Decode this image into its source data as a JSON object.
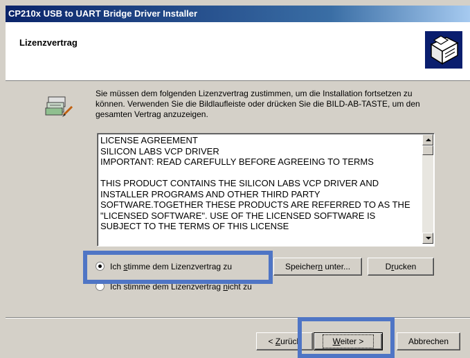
{
  "window": {
    "title": "CP210x USB to UART Bridge Driver Installer"
  },
  "header": {
    "title": "Lizenzvertrag",
    "icon": "installer-box-icon"
  },
  "content": {
    "intro": "Sie müssen dem folgenden Lizenzvertrag zustimmen, um die Installation fortsetzen zu können. Verwenden Sie die Bildlaufleiste oder drücken Sie die BILD-AB-TASTE, um den gesamten Vertrag anzuzeigen.",
    "license_text": "LICENSE AGREEMENT\nSILICON LABS VCP DRIVER\nIMPORTANT:  READ CAREFULLY BEFORE AGREEING TO TERMS\n\nTHIS PRODUCT CONTAINS THE SILICON LABS VCP DRIVER AND INSTALLER PROGRAMS AND OTHER THIRD PARTY SOFTWARE.TOGETHER THESE PRODUCTS ARE REFERRED TO AS THE \"LICENSED SOFTWARE\".  USE OF THE LICENSED SOFTWARE IS SUBJECT TO THE TERMS OF THIS LICENSE",
    "radio_accept": {
      "pre": "Ich ",
      "mnemonic": "s",
      "post": "timme dem Lizenzvertrag zu",
      "checked": true
    },
    "radio_decline": {
      "pre": "Ich stimme dem Lizenzvertrag ",
      "mnemonic": "n",
      "post": "icht zu",
      "checked": false
    },
    "save_button": {
      "pre": "Speicher",
      "mnemonic": "n",
      "post": " unter..."
    },
    "print_button": {
      "pre": "D",
      "mnemonic": "r",
      "post": "ucken"
    }
  },
  "footer": {
    "back_button": {
      "pre": "< ",
      "mnemonic": "Z",
      "post": "urück"
    },
    "next_button": {
      "pre": "",
      "mnemonic": "W",
      "post": "eiter >"
    },
    "cancel_button": "Abbrechen"
  },
  "colors": {
    "title_gradient_start": "#0a246a",
    "highlight": "#4f75c5",
    "dialog_face": "#d4d0c8"
  }
}
